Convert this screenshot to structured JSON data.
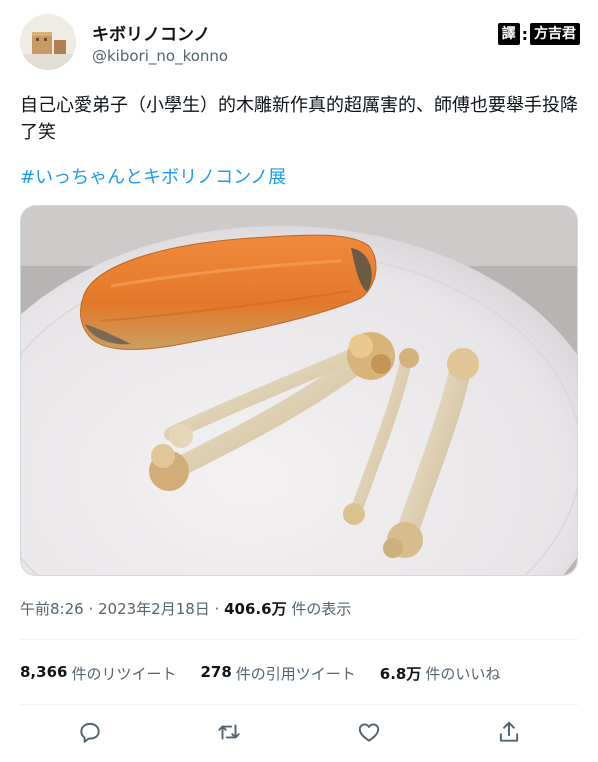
{
  "author": {
    "display_name": "キボリノコンノ",
    "handle": "@kibori_no_konno",
    "avatar_icon": "avatar-image"
  },
  "translator_badge": {
    "left": "譯",
    "sep": ":",
    "right": "方吉君"
  },
  "tweet": {
    "text": "自己心愛弟子（小學生）的木雕新作真的超厲害的、師傅也要舉手投降了笑",
    "hashtag": "#いっちゃんとキボリノコンノ展"
  },
  "meta": {
    "timestamp": "午前8:26 · 2023年2月18日 ·",
    "views": "406.6万",
    "views_suffix": "件の表示"
  },
  "stats": {
    "retweets_count": "8,366",
    "retweets_label": "件のリツイート",
    "quotes_count": "278",
    "quotes_label": "件の引用ツイート",
    "likes_count": "6.8万",
    "likes_label": "件のいいね"
  },
  "actions": {
    "reply_icon": "reply-icon",
    "retweet_icon": "retweet-icon",
    "like_icon": "heart-icon",
    "share_icon": "share-icon"
  },
  "colors": {
    "link": "#1d9bf0",
    "secondary_text": "#536471",
    "primary_text": "#0f1419"
  }
}
